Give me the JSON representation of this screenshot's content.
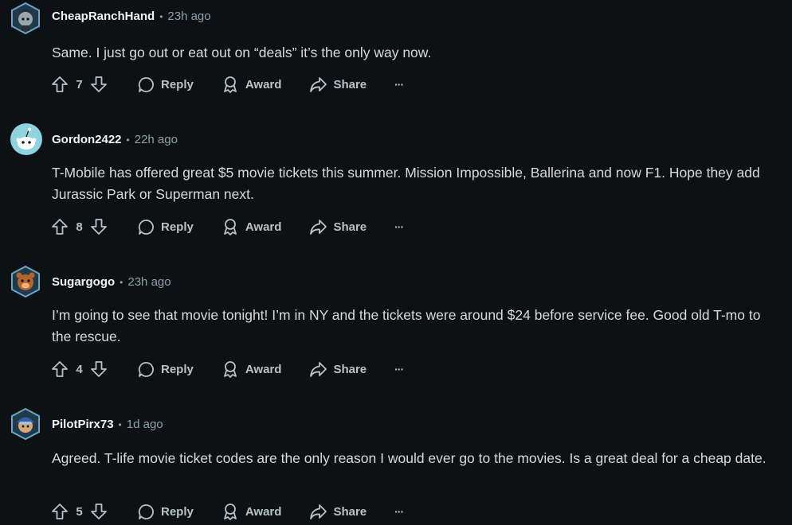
{
  "actions": {
    "reply_label": "Reply",
    "award_label": "Award",
    "share_label": "Share",
    "more_label": "···"
  },
  "separator": "•",
  "comments": [
    {
      "author": "CheapRanchHand",
      "time": "23h ago",
      "text": "Same. I just go out or eat out on “deals” it’s the only way now.",
      "votes": "7",
      "avatar_icon": "snoo-avatar-hooded-icon"
    },
    {
      "author": "Gordon2422",
      "time": "22h ago",
      "text": "T-Mobile has offered great $5 movie tickets this summer. Mission Impossible, Ballerina and now F1. Hope they add Jurassic Park or Superman next.",
      "votes": "8",
      "avatar_icon": "default-snoo-avatar-icon"
    },
    {
      "author": "Sugargogo",
      "time": "23h ago",
      "text": "I’m going to see that movie tonight! I’m in NY and the tickets were around $24 before service fee. Good old T-mo to the rescue.",
      "votes": "4",
      "avatar_icon": "snoo-avatar-bear-icon"
    },
    {
      "author": "PilotPirx73",
      "time": "1d ago",
      "text": "Agreed. T-life movie ticket codes are the only reason I would ever go to the movies. Is a great deal for a cheap date.",
      "votes": "5",
      "avatar_icon": "snoo-avatar-pilot-icon"
    }
  ],
  "colors": {
    "background": "#0e1113",
    "author": "#f2f4f5",
    "meta": "#8ba2ad",
    "body_text": "#d7dadc",
    "action_text": "#b7c3c9",
    "avatar_ring": "#4f8fb0"
  }
}
